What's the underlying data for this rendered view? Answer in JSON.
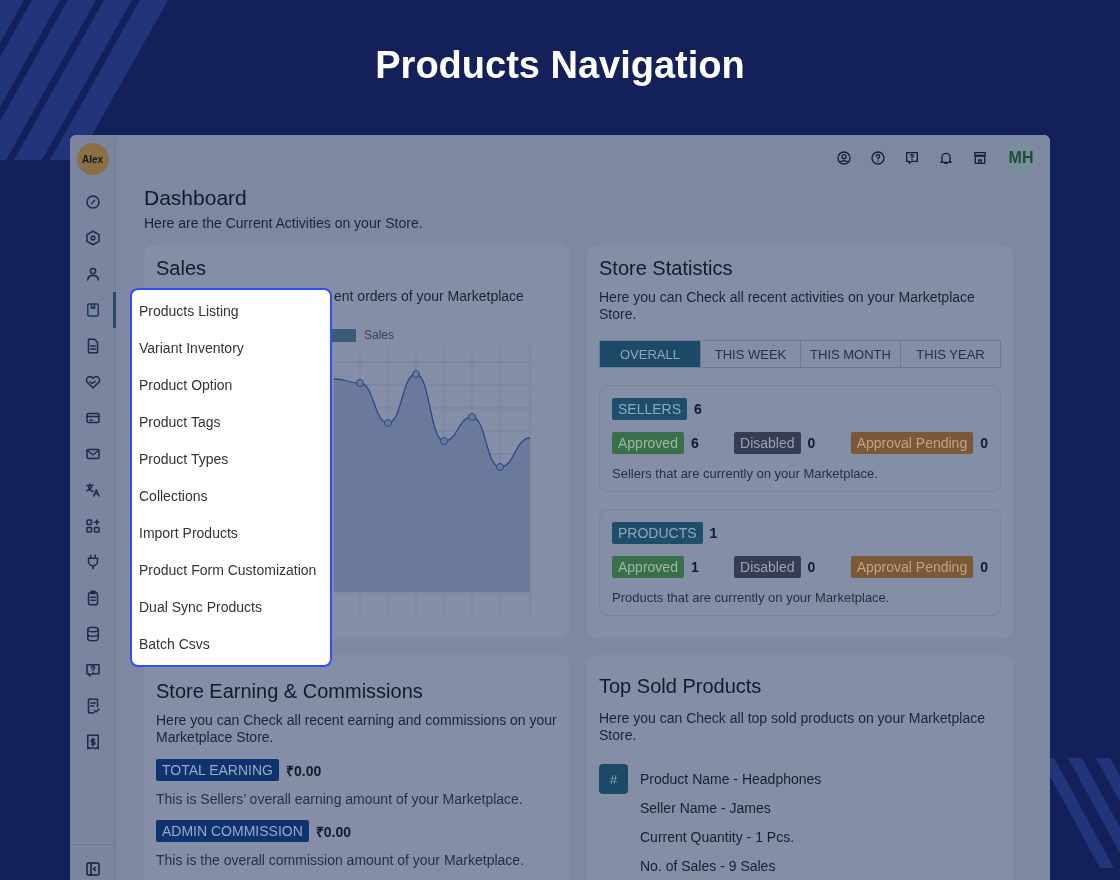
{
  "page_title": "Products Navigation",
  "sidebar": {
    "avatar": "Alex",
    "items": [
      {
        "selected": false
      },
      {
        "selected": false
      },
      {
        "selected": false
      },
      {
        "selected": true
      },
      {
        "selected": false
      },
      {
        "selected": false
      },
      {
        "selected": false
      },
      {
        "selected": false
      },
      {
        "selected": false
      },
      {
        "selected": false
      },
      {
        "selected": false
      },
      {
        "selected": false
      },
      {
        "selected": false
      },
      {
        "selected": false
      },
      {
        "selected": false
      },
      {
        "selected": false
      }
    ]
  },
  "header": {
    "avatar": "MH"
  },
  "dashboard": {
    "title": "Dashboard",
    "subtitle": "Here are the Current Activities on your Store."
  },
  "sales": {
    "title": "Sales",
    "subtitle": "ent orders of your Marketplace",
    "legend": "Sales"
  },
  "menu": {
    "items": [
      "Products Listing",
      "Variant Inventory",
      "Product Option",
      "Product Tags",
      "Product Types",
      "Collections",
      "Import Products",
      "Product Form Customization",
      "Dual Sync Products",
      "Batch Csvs"
    ]
  },
  "store_statistics": {
    "title": "Store Statistics",
    "subtitle": "Here you can Check all recent activities on your Marketplace Store.",
    "tabs": [
      {
        "label": "OVERALL",
        "selected": true
      },
      {
        "label": "THIS WEEK",
        "selected": false
      },
      {
        "label": "THIS MONTH",
        "selected": false
      },
      {
        "label": "THIS YEAR",
        "selected": false
      }
    ],
    "groups": [
      {
        "label": "SELLERS",
        "count": "6",
        "statuses": [
          {
            "kind": "approved",
            "label": "Approved",
            "count": "6"
          },
          {
            "kind": "disabled",
            "label": "Disabled",
            "count": "0"
          },
          {
            "kind": "pending",
            "label": "Approval Pending",
            "count": "0"
          }
        ],
        "note": "Sellers that are currently on your Marketplace."
      },
      {
        "label": "PRODUCTS",
        "count": "1",
        "statuses": [
          {
            "kind": "approved",
            "label": "Approved",
            "count": "1"
          },
          {
            "kind": "disabled",
            "label": "Disabled",
            "count": "0"
          },
          {
            "kind": "pending",
            "label": "Approval Pending",
            "count": "0"
          }
        ],
        "note": "Products that are currently on your Marketplace."
      }
    ]
  },
  "earnings": {
    "title": "Store Earning & Commissions",
    "subtitle": "Here you can Check all recent earning and commissions on your Marketplace Store.",
    "items": [
      {
        "label": "TOTAL EARNING",
        "amount": "₹0.00",
        "note": "This is Sellers’ overall earning amount of your Marketplace."
      },
      {
        "label": "ADMIN COMMISSION",
        "amount": "₹0.00",
        "note": "This is the overall commission amount of your Marketplace."
      }
    ]
  },
  "top_sold": {
    "title": "Top Sold Products",
    "subtitle": "Here you can Check all top sold products on your Marketplace Store.",
    "marker": "#",
    "lines": [
      "Product Name - Headphones",
      "Seller Name - James",
      "Current Quantity - 1 Pcs.",
      "No. of Sales - 9 Sales"
    ]
  }
}
